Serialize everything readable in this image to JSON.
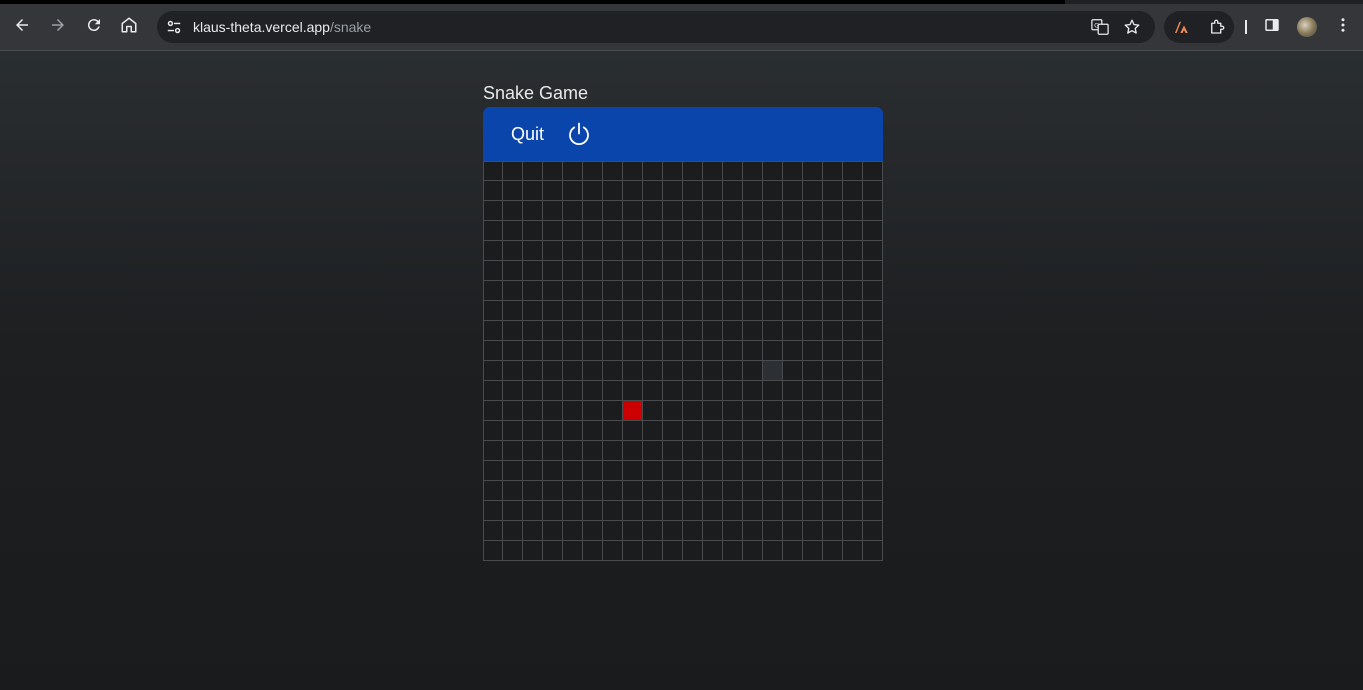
{
  "browser": {
    "url_host": "klaus-theta.vercel.app",
    "url_path": "/snake",
    "icons": {
      "back": "back-arrow-icon",
      "forward": "forward-arrow-icon",
      "reload": "reload-icon",
      "home": "home-icon",
      "site_info": "site-settings-icon",
      "translate": "translate-icon",
      "bookmark": "star-icon",
      "extension_1": "extension-app-icon",
      "extensions": "puzzle-icon",
      "side_panel": "side-panel-icon",
      "profile": "avatar",
      "menu": "kebab-menu-icon"
    }
  },
  "game": {
    "title": "Snake Game",
    "quit_label": "Quit",
    "power_icon": "power-icon",
    "grid": {
      "columns": 20,
      "rows": 20
    },
    "food": {
      "col": 7,
      "row": 12
    },
    "snake": [
      {
        "col": 14,
        "row": 10
      }
    ],
    "colors": {
      "header": "#0a45ab",
      "food": "#cc0000",
      "snake": "#2c3034",
      "grid_line": "#4a4b4e"
    }
  }
}
